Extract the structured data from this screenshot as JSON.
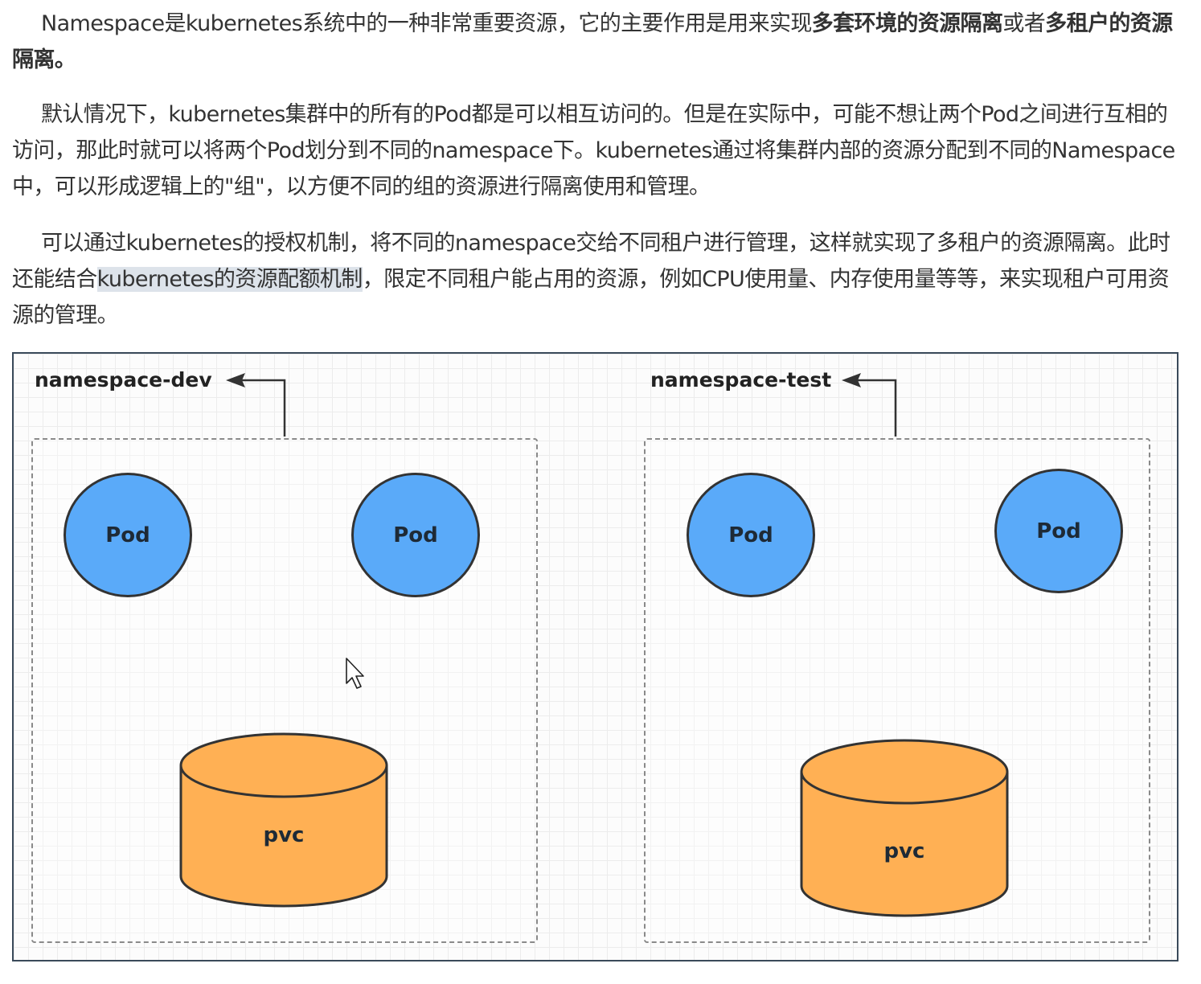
{
  "article": {
    "p1": {
      "text_a": "Namespace是kubernetes系统中的一种非常重要资源，它的主要作用是用来实现",
      "bold_a": "多套环境的资源隔离",
      "text_b": "或者",
      "bold_b": "多租户的资源隔离。"
    },
    "p2": {
      "text": "默认情况下，kubernetes集群中的所有的Pod都是可以相互访问的。但是在实际中，可能不想让两个Pod之间进行互相的访问，那此时就可以将两个Pod划分到不同的namespace下。kubernetes通过将集群内部的资源分配到不同的Namespace中，可以形成逻辑上的\"组\"，以方便不同的组的资源进行隔离使用和管理。"
    },
    "p3": {
      "text_a": "可以通过kubernetes的授权机制，将不同的namespace交给不同租户进行管理，这样就实现了多租户的资源隔离。此时还能结合",
      "highlight": "kubernetes的资源配额机制",
      "text_b": "，限定不同租户能占用的资源，例如CPU使用量、内存使用量等等，来实现租户可用资源的管理。"
    }
  },
  "diagram": {
    "namespaces": [
      {
        "label": "namespace-dev",
        "pods": [
          "Pod",
          "Pod"
        ],
        "pvc": "pvc"
      },
      {
        "label": "namespace-test",
        "pods": [
          "Pod",
          "Pod"
        ],
        "pvc": "pvc"
      }
    ],
    "colors": {
      "pod_fill": "#5aaaf9",
      "pvc_fill": "#ffb054",
      "outline": "#333333",
      "dashed_border": "#8a8a8a"
    }
  },
  "icons": {
    "cursor": "mouse-pointer-icon",
    "arrow": "arrow-left-icon"
  }
}
